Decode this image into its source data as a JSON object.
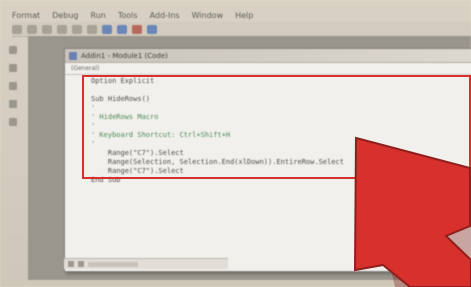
{
  "menubar": {
    "items": [
      "Format",
      "Debug",
      "Run",
      "Tools",
      "Add-Ins",
      "Window",
      "Help"
    ]
  },
  "toolbar": {
    "icons": [
      "save-icon",
      "cut-icon",
      "copy-icon",
      "paste-icon",
      "undo-icon",
      "redo-icon",
      "run-icon",
      "pause-icon",
      "stop-icon",
      "design-icon"
    ]
  },
  "code_window": {
    "title": "Addin1 - Module1 (Code)",
    "combo_left": "(General)",
    "lines": [
      "Option Explicit",
      "",
      "Sub HideRows()",
      "'",
      "' HideRows Macro",
      "'",
      "' Keyboard Shortcut: Ctrl+Shift+H",
      "'",
      "    Range(\"C7\").Select",
      "    Range(Selection, Selection.End(xlDown)).EntireRow.Select",
      "    Range(\"C7\").Select",
      "End Sub"
    ]
  },
  "colors": {
    "highlight": "#d8302c",
    "arrow": "#d8302c",
    "comment": "#4b8a57"
  }
}
